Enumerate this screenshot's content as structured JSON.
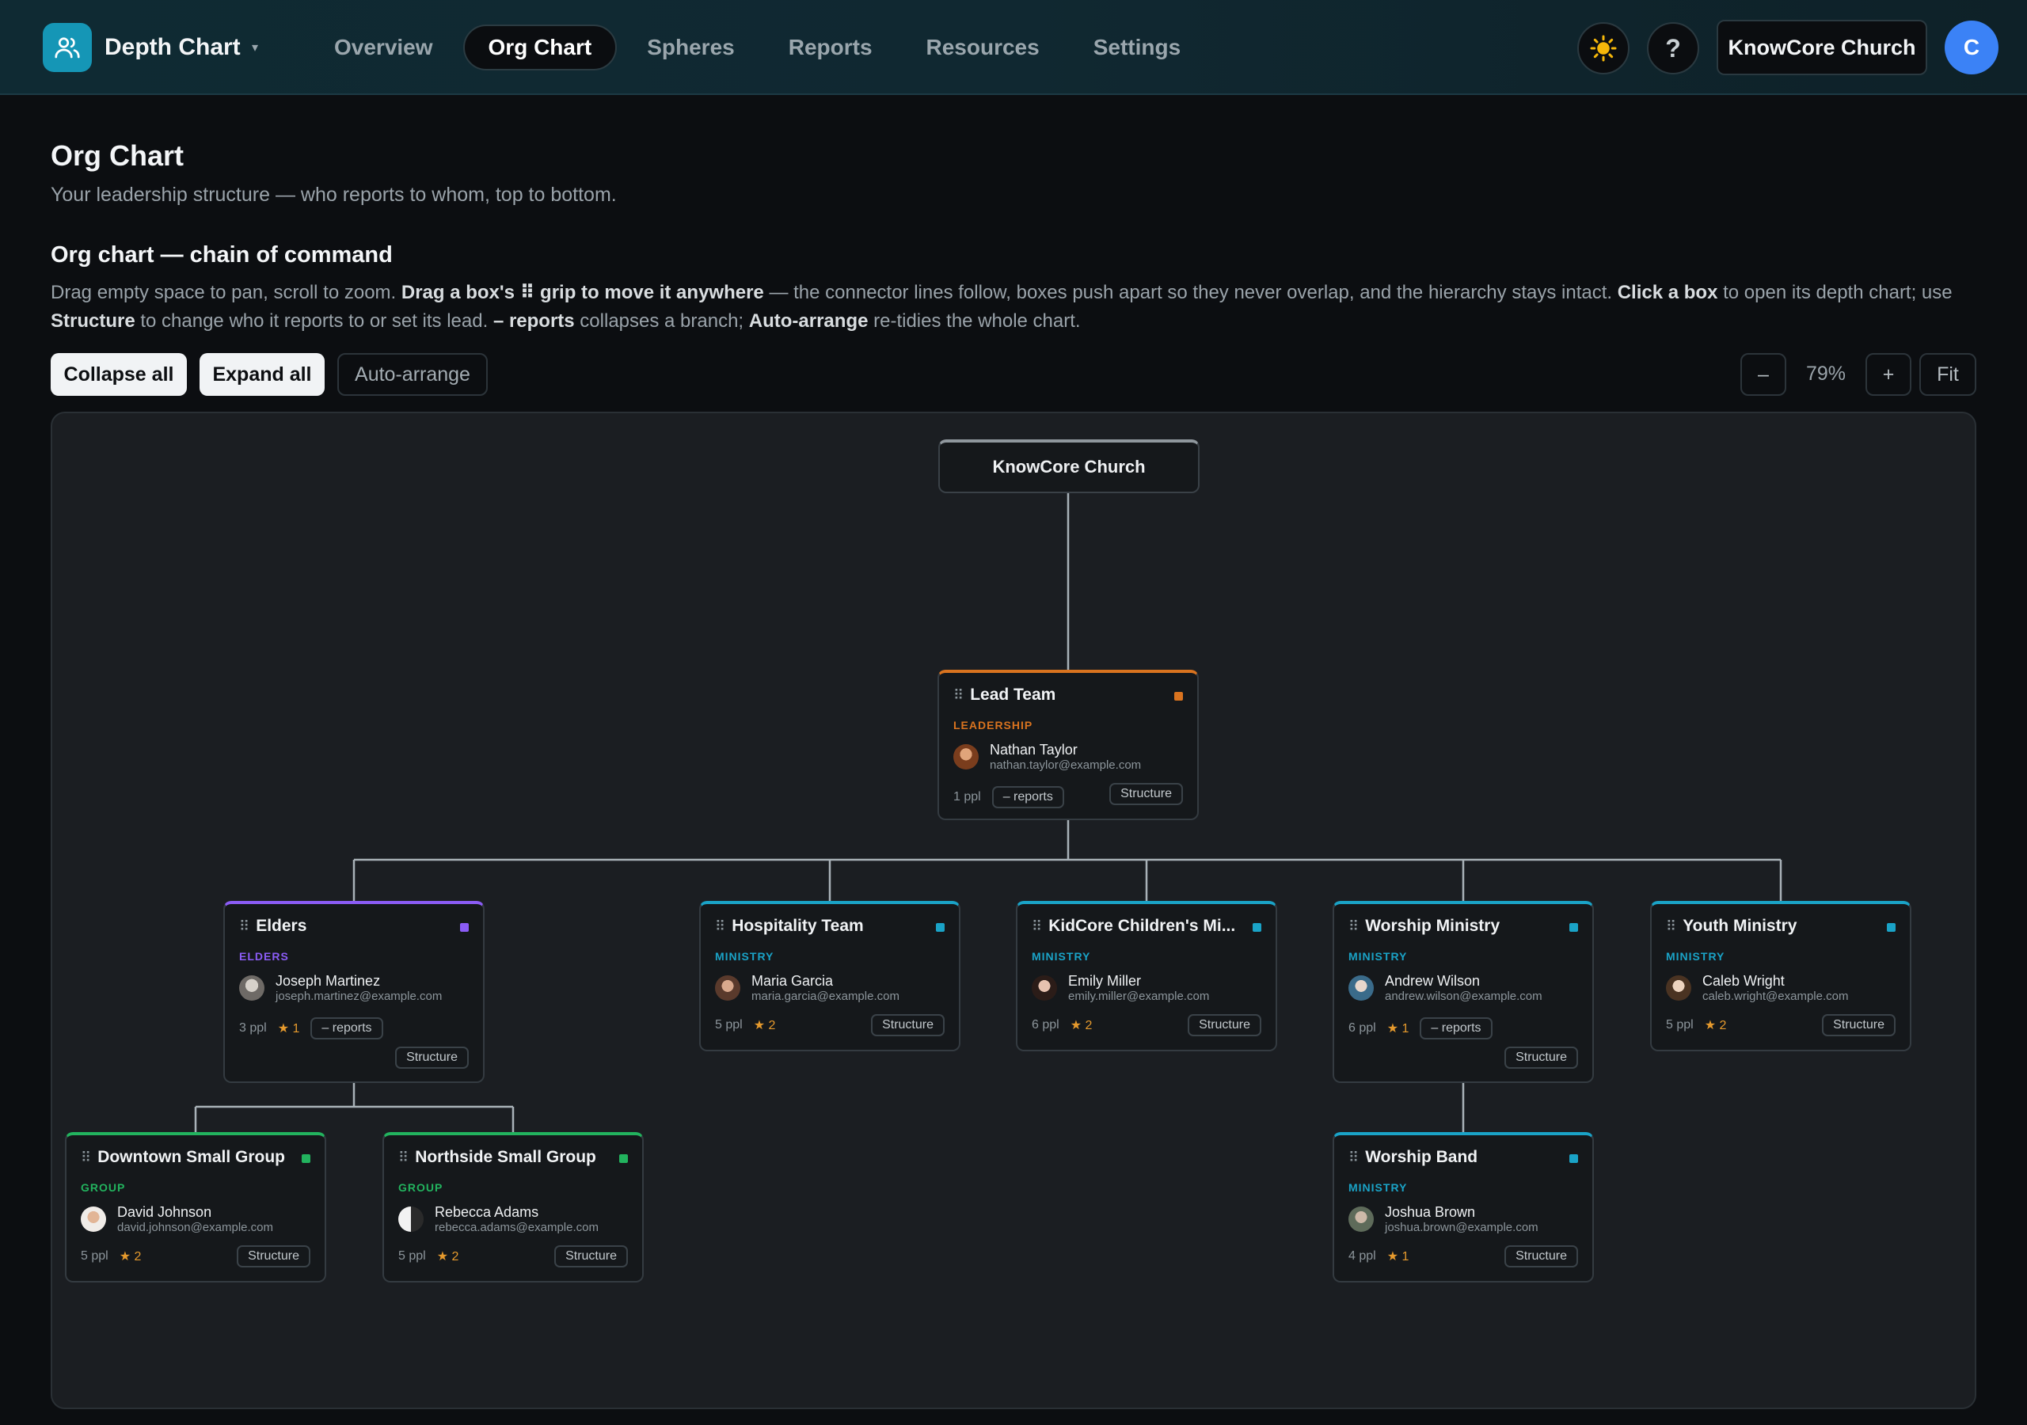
{
  "header": {
    "app_title": "Depth Chart",
    "caret": "▾",
    "nav": [
      {
        "label": "Overview",
        "active": false
      },
      {
        "label": "Org Chart",
        "active": true
      },
      {
        "label": "Spheres",
        "active": false
      },
      {
        "label": "Reports",
        "active": false
      },
      {
        "label": "Resources",
        "active": false
      },
      {
        "label": "Settings",
        "active": false
      }
    ],
    "help_label": "?",
    "org_button": "KnowCore Church",
    "avatar_letter": "C"
  },
  "page": {
    "title": "Org Chart",
    "subtitle": "Your leadership structure — who reports to whom, top to bottom."
  },
  "section": {
    "title": "Org chart — chain of command",
    "desc": [
      {
        "t": "Drag empty space to pan, scroll to zoom. ",
        "b": false
      },
      {
        "t": "Drag a box's ⠿ grip to move it anywhere",
        "b": true
      },
      {
        "t": " — the connector lines follow, boxes push apart so they never overlap, and the hierarchy stays intact. ",
        "b": false
      },
      {
        "t": "Click a box",
        "b": true
      },
      {
        "t": " to open its depth chart; use ",
        "b": false
      },
      {
        "t": "Structure",
        "b": true
      },
      {
        "t": " to change who it reports to or set its lead. ",
        "b": false
      },
      {
        "t": "– reports",
        "b": true
      },
      {
        "t": " collapses a branch; ",
        "b": false
      },
      {
        "t": "Auto-arrange",
        "b": true
      },
      {
        "t": " re-tidies the whole chart.",
        "b": false
      }
    ]
  },
  "toolbar": {
    "collapse_all": "Collapse all",
    "expand_all": "Expand all",
    "auto_arrange": "Auto-arrange",
    "zoom_out": "–",
    "zoom_level": "79%",
    "zoom_in": "+",
    "fit": "Fit"
  },
  "chart": {
    "root": "KnowCore Church",
    "structure_label": "Structure",
    "reports_label": "– reports",
    "colors": {
      "leadership": "#d9731f",
      "elders": "#8b5cf6",
      "ministry": "#1aa3c7",
      "group": "#22b35e"
    },
    "nodes": {
      "lead": {
        "title": "Lead Team",
        "kind": "LEADERSHIP",
        "lead": "Nathan Taylor",
        "email": "nathan.taylor@example.com",
        "people": "1 ppl",
        "stars": ""
      },
      "elders": {
        "title": "Elders",
        "kind": "ELDERS",
        "lead": "Joseph Martinez",
        "email": "joseph.martinez@example.com",
        "people": "3 ppl",
        "stars": "★ 1"
      },
      "hospitality": {
        "title": "Hospitality Team",
        "kind": "MINISTRY",
        "lead": "Maria Garcia",
        "email": "maria.garcia@example.com",
        "people": "5 ppl",
        "stars": "★ 2"
      },
      "kids": {
        "title": "KidCore Children's Mi...",
        "kind": "MINISTRY",
        "lead": "Emily Miller",
        "email": "emily.miller@example.com",
        "people": "6 ppl",
        "stars": "★ 2"
      },
      "worship": {
        "title": "Worship Ministry",
        "kind": "MINISTRY",
        "lead": "Andrew Wilson",
        "email": "andrew.wilson@example.com",
        "people": "6 ppl",
        "stars": "★ 1"
      },
      "youth": {
        "title": "Youth Ministry",
        "kind": "MINISTRY",
        "lead": "Caleb Wright",
        "email": "caleb.wright@example.com",
        "people": "5 ppl",
        "stars": "★ 2"
      },
      "downtown": {
        "title": "Downtown Small Group",
        "kind": "GROUP",
        "lead": "David Johnson",
        "email": "david.johnson@example.com",
        "people": "5 ppl",
        "stars": "★ 2"
      },
      "northside": {
        "title": "Northside Small Group",
        "kind": "GROUP",
        "lead": "Rebecca Adams",
        "email": "rebecca.adams@example.com",
        "people": "5 ppl",
        "stars": "★ 2"
      },
      "band": {
        "title": "Worship Band",
        "kind": "MINISTRY",
        "lead": "Joshua Brown",
        "email": "joshua.brown@example.com",
        "people": "4 ppl",
        "stars": "★ 1"
      }
    }
  }
}
